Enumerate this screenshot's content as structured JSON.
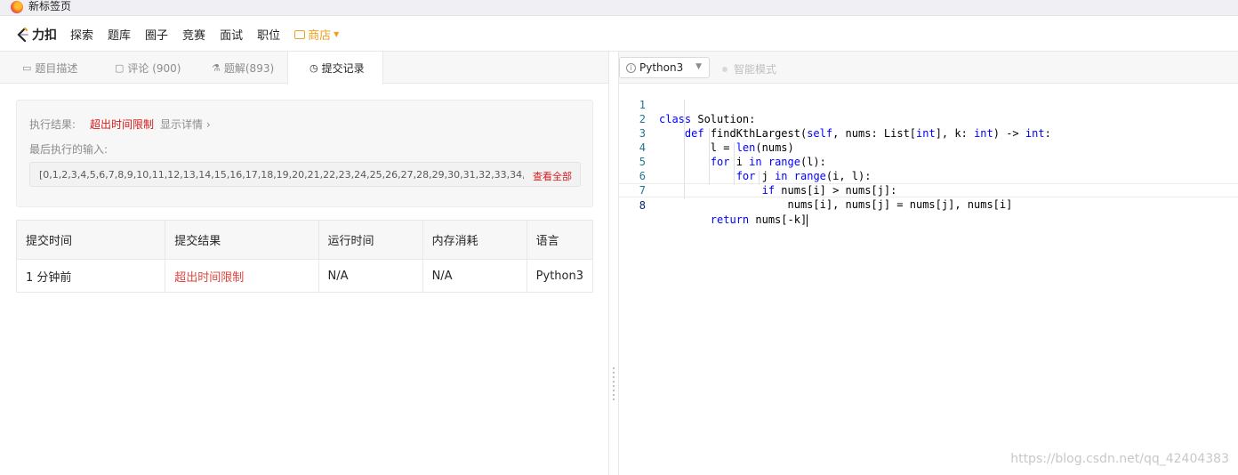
{
  "browser": {
    "tab_title": "新标签页"
  },
  "nav": {
    "logo_text": "力扣",
    "links": [
      "探索",
      "题库",
      "圈子",
      "竞赛",
      "面试",
      "职位"
    ],
    "shop_label": "商店"
  },
  "left_tabs": [
    {
      "label": "题目描述",
      "icon": "description-icon"
    },
    {
      "label": "评论 (900)",
      "icon": "comment-icon"
    },
    {
      "label": "题解(893)",
      "icon": "flask-icon"
    },
    {
      "label": "提交记录",
      "icon": "clock-icon",
      "active": true
    }
  ],
  "result": {
    "label": "执行结果:",
    "status": "超出时间限制",
    "detail_link": "显示详情 ›",
    "last_input_label": "最后执行的输入:",
    "last_input_value": "[0,1,2,3,4,5,6,7,8,9,10,11,12,13,14,15,16,17,18,19,20,21,22,23,24,25,26,27,28,29,30,31,32,33,34,35,36,37,38,...",
    "view_all": "查看全部"
  },
  "submissions": {
    "headers": [
      "提交时间",
      "提交结果",
      "运行时间",
      "内存消耗",
      "语言"
    ],
    "rows": [
      [
        "1 分钟前",
        "超出时间限制",
        "N/A",
        "N/A",
        "Python3"
      ]
    ]
  },
  "editor_toolbar": {
    "language": "Python3",
    "smart_mode": "智能模式"
  },
  "code_lines": [
    "class Solution:",
    "    def findKthLargest(self, nums: List[int], k: int) -> int:",
    "        l = len(nums)",
    "        for i in range(l):",
    "            for j in range(i, l):",
    "                if nums[i] > nums[j]:",
    "                    nums[i], nums[j] = nums[j], nums[i]",
    "        return nums[-k]"
  ],
  "watermark": "https://blog.csdn.net/qq_42404383",
  "colors": {
    "accent_error": "#d81b1b",
    "keyword": "#0000ff",
    "line_number": "#237893"
  }
}
